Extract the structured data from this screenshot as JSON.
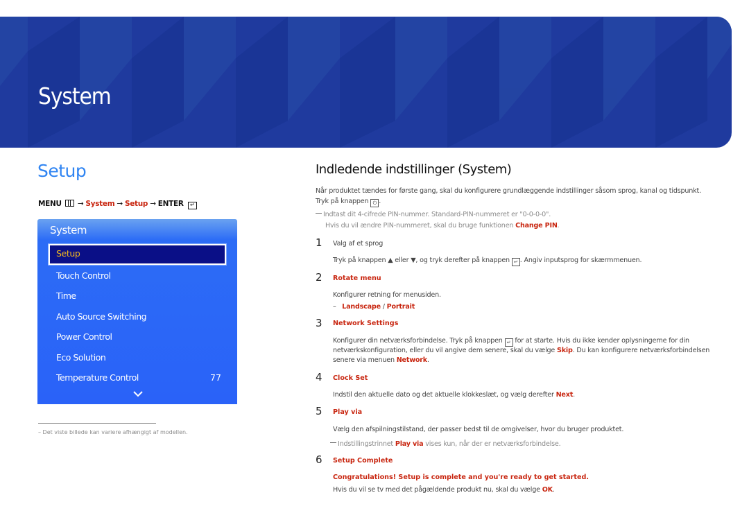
{
  "banner": {
    "title": "System",
    "color": "#1f3a9e"
  },
  "section": {
    "title": "Setup",
    "breadcrumb": {
      "menu": "MENU",
      "arrow": "→",
      "system": "System",
      "setup": "Setup",
      "enter": "ENTER"
    }
  },
  "menu_panel": {
    "title": "System",
    "selected": "Setup",
    "items": [
      {
        "label": "Touch Control"
      },
      {
        "label": "Time"
      },
      {
        "label": "Auto Source Switching"
      },
      {
        "label": "Power Control"
      },
      {
        "label": "Eco Solution"
      },
      {
        "label": "Temperature Control",
        "value": "77"
      }
    ]
  },
  "footnote": "Det viste billede kan variere afhængigt af modellen.",
  "content": {
    "heading": "Indledende indstillinger (System)",
    "intro1": "Når produktet tændes for første gang, skal du konfigurere grundlæggende indstillinger såsom sprog, kanal og tidspunkt.",
    "intro2a": "Tryk på knappen",
    "intro2b": ".",
    "note1a": "Indtast dit 4-cifrede PIN-nummer. Standard-PIN-nummeret er \"0-0-0-0\".",
    "note1b": "Hvis du vil ændre PIN-nummeret, skal du bruge funktionen",
    "note1c": "Change PIN",
    "steps": [
      {
        "num": "1",
        "title": "Valg af et sprog",
        "t1": "Tryk på knappen",
        "t2": "eller",
        "t3": ", og tryk derefter på knappen",
        "t4": ". Angiv inputsprog for skærmmenuen."
      },
      {
        "num": "2",
        "title": "Rotate menu",
        "t1": "Konfigurer retning for menusiden.",
        "opt1": "Landscape",
        "sep": "/",
        "opt2": "Portrait"
      },
      {
        "num": "3",
        "title": "Network Settings",
        "l1a": "Konfigurer din netværksforbindelse. Tryk på knappen",
        "l1b": "for at starte. Hvis du ikke kender oplysningerne for din",
        "l2a": "netværkskonfiguration, eller du vil angive dem senere, skal du vælge",
        "l2b": "Skip",
        "l2c": ". Du kan konfigurere netværksforbindelsen",
        "l3a": "senere via menuen",
        "l3b": "Network",
        "l3c": "."
      },
      {
        "num": "4",
        "title": "Clock Set",
        "t1": "Indstil den aktuelle dato og det aktuelle klokkeslæt, og vælg derefter",
        "t2": "Next",
        "t3": "."
      },
      {
        "num": "5",
        "title": "Play via",
        "t1": "Vælg den afspilningstilstand, der passer bedst til de omgivelser, hvor du bruger produktet.",
        "n1": "Indstillingstrinnet",
        "n2": "Play via",
        "n3": "vises kun, når der er netværksforbindelse."
      },
      {
        "num": "6",
        "title": "Setup Complete",
        "t1": "Congratulations! Setup is complete and you're ready to get started.",
        "t2": "Hvis du vil se tv med det pågældende produkt nu, skal du vælge",
        "t3": "OK",
        "t4": "."
      }
    ]
  },
  "colors": {
    "accent_red": "#c8250f",
    "heading_blue": "#2f84f2",
    "panel_blue": "#2a62f8",
    "selected_bg": "#0a0f87",
    "selected_text": "#f3b81f"
  }
}
